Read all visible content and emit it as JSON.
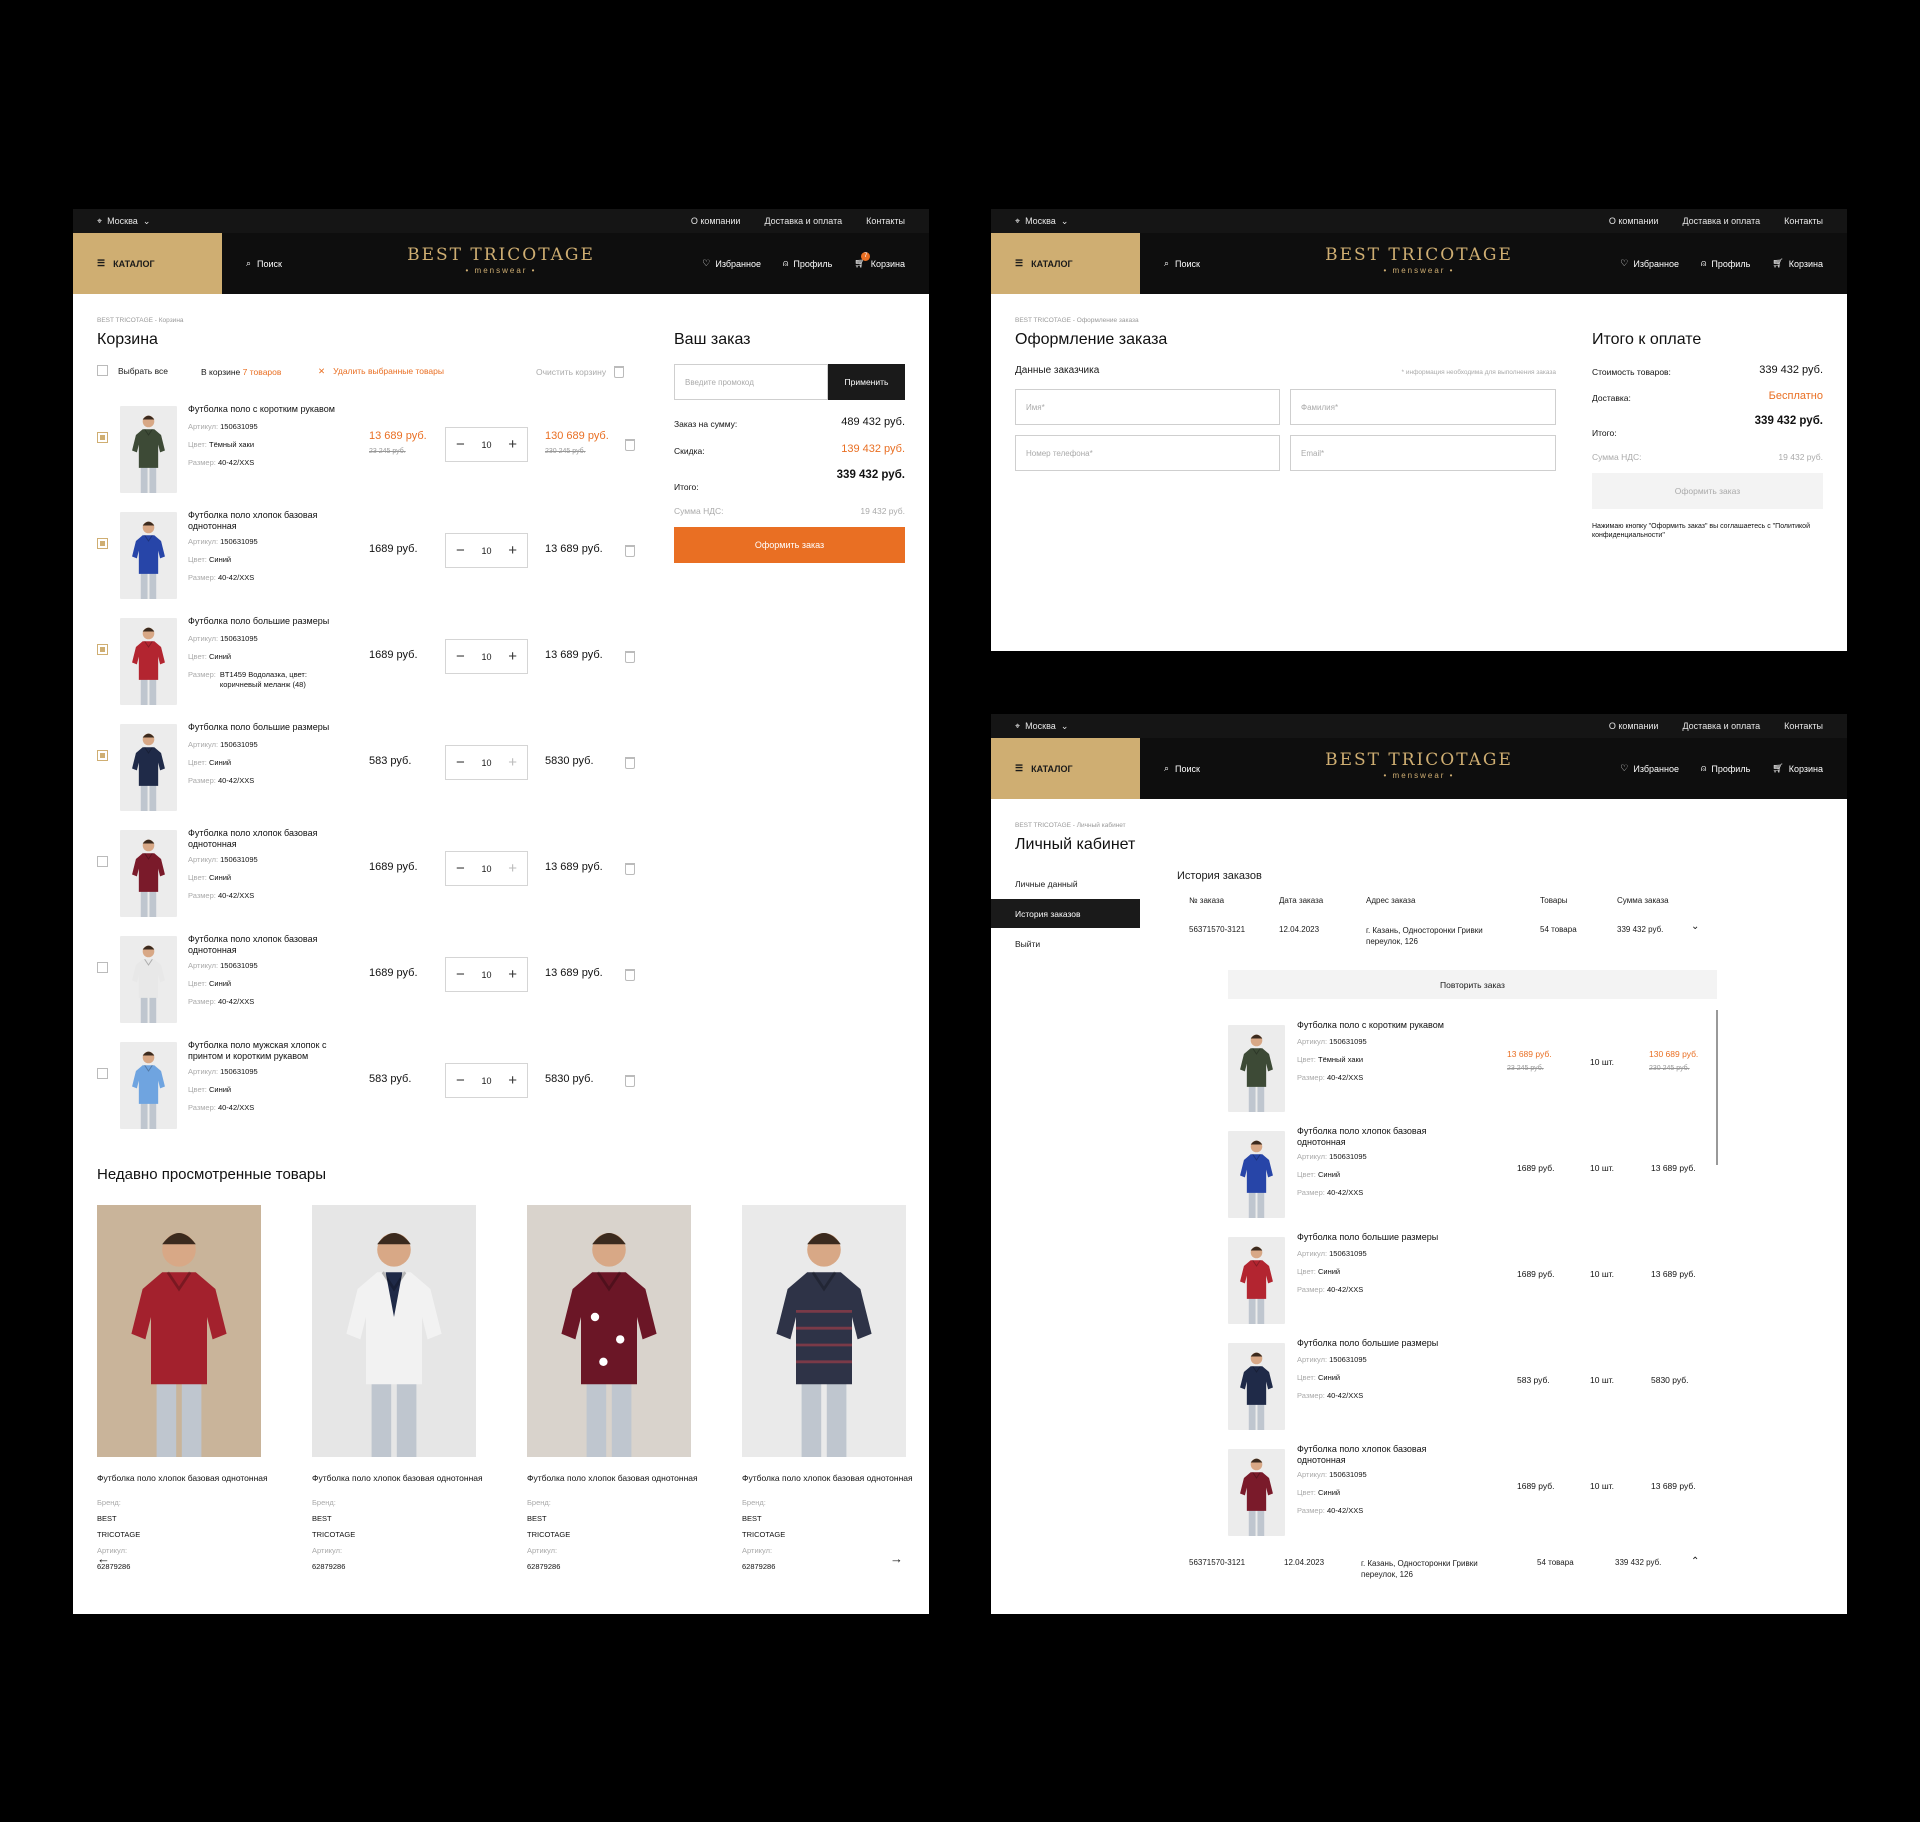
{
  "common": {
    "city": "Москва",
    "links": [
      "О компании",
      "Доставка и оплата",
      "Контакты"
    ],
    "catalog": "КАТАЛОГ",
    "search": "Поиск",
    "logo_main": "BEST TRICOTAGE",
    "logo_sub": "• menswear •",
    "favorites": "Избранное",
    "profile": "Профиль",
    "cart": "Корзина",
    "cart_count": "7",
    "brand_color": "#cfae72",
    "accent_color": "#e96f23"
  },
  "cart_page": {
    "breadcrumb": "BEST TRICOTAGE - Корзина",
    "title": "Корзина",
    "select_all": "Выбрать все",
    "in_cart_prefix": "В корзине",
    "in_cart_count": "7 товаров",
    "delete_selected": "Удалить выбранные товары",
    "clear_cart": "Очистить корзину",
    "meta_labels": {
      "article": "Артикул:",
      "color": "Цвет:",
      "size": "Размер:"
    },
    "items": [
      {
        "name": "Футболка поло с коротким рукавом",
        "article": "150631095",
        "color": "Тёмный хаки",
        "size": "40-42/XXS",
        "price": "13 689 руб.",
        "price_old": "23 245 руб.",
        "qty": "10",
        "total": "130 689 руб.",
        "total_old": "230 245 руб.",
        "checked": true,
        "discount": true
      },
      {
        "name": "Футболка поло хлопок базовая однотонная",
        "article": "150631095",
        "color": "Синий",
        "size": "40-42/XXS",
        "price": "1689 руб.",
        "qty": "10",
        "total": "13 689 руб.",
        "checked": true
      },
      {
        "name": "Футболка поло большие размеры",
        "article": "150631095",
        "color": "Синий",
        "size": "BT1459 Водолазка, цвет: коричневый меланж (48)",
        "price": "1689 руб.",
        "qty": "10",
        "total": "13 689 руб.",
        "checked": true
      },
      {
        "name": "Футболка поло большие размеры",
        "article": "150631095",
        "color": "Синий",
        "size": "40-42/XXS",
        "price": "583 руб.",
        "qty": "10",
        "total": "5830 руб.",
        "checked": true
      },
      {
        "name": "Футболка поло хлопок базовая однотонная",
        "article": "150631095",
        "color": "Синий",
        "size": "40-42/XXS",
        "price": "1689 руб.",
        "qty": "10",
        "total": "13 689 руб.",
        "checked": false
      },
      {
        "name": "Футболка поло хлопок базовая однотонная",
        "article": "150631095",
        "color": "Синий",
        "size": "40-42/XXS",
        "price": "1689 руб.",
        "qty": "10",
        "total": "13 689 руб.",
        "checked": false
      },
      {
        "name": "Футболка поло мужская хлопок с принтом и коротким рукавом",
        "article": "150631095",
        "color": "Синий",
        "size": "40-42/XXS",
        "price": "583 руб.",
        "qty": "10",
        "total": "5830 руб.",
        "checked": false
      }
    ],
    "order": {
      "title": "Ваш заказ",
      "promo_placeholder": "Введите промокод",
      "apply": "Применить",
      "sum_label": "Заказ на сумму:",
      "sum_value": "489 432 руб.",
      "discount_label": "Скидка:",
      "discount_value": "139 432 руб.",
      "subtotal": "339 432 руб.",
      "total_label": "Итого:",
      "vat_label": "Сумма НДС:",
      "vat_value": "19 432 руб.",
      "checkout": "Оформить заказ"
    },
    "recent": {
      "title": "Недавно просмотренные товары",
      "brand_label": "Бренд:",
      "article_label": "Артикул:",
      "cards": [
        {
          "name": "Футболка поло хлопок базовая однотонная",
          "brand": "BEST TRICOTAGE",
          "article": "62879286"
        },
        {
          "name": "Футболка поло хлопок базовая однотонная",
          "brand": "BEST TRICOTAGE",
          "article": "62879286"
        },
        {
          "name": "Футболка поло хлопок базовая однотонная",
          "brand": "BEST TRICOTAGE",
          "article": "62879286"
        },
        {
          "name": "Футболка поло хлопок базовая однотонная",
          "brand": "BEST TRICOTAGE",
          "article": "62879286"
        }
      ]
    }
  },
  "checkout_page": {
    "breadcrumb": "BEST TRICOTAGE - Оформление заказа",
    "title": "Оформление заказа",
    "customer_data": "Данные заказчика",
    "required_note": "* информация необходима для выполнения заказа",
    "fields": {
      "first_name": "Имя*",
      "last_name": "Фамилия*",
      "phone": "Номер телефона*",
      "email": "Email*"
    },
    "summary": {
      "title": "Итого к оплате",
      "goods_label": "Стоимость товаров:",
      "goods_value": "339 432 руб.",
      "delivery_label": "Доставка:",
      "delivery_value": "Бесплатно",
      "total_value": "339 432 руб.",
      "total_label": "Итого:",
      "vat_label": "Сумма НДС:",
      "vat_value": "19 432 руб.",
      "button": "Оформить заказ",
      "note": "Нажимаю кнопку \"Оформить заказ\" вы соглашаетесь с \"Политикой конфиденциальности\""
    }
  },
  "account_page": {
    "breadcrumb": "BEST TRICOTAGE - Личный кабинет",
    "title": "Личный кабинет",
    "menu": [
      "Личные данный",
      "История заказов",
      "Выйти"
    ],
    "history_title": "История заказов",
    "columns": [
      "№ заказа",
      "Дата заказа",
      "Адрес заказа",
      "Товары",
      "Сумма заказа"
    ],
    "orders": [
      {
        "number": "56371570-3121",
        "date": "12.04.2023",
        "address": "г. Казань, Односторонки Гривки переулок, 126",
        "goods": "54 товара",
        "sum": "339 432 руб."
      },
      {
        "number": "56371570-3121",
        "date": "12.04.2023",
        "address": "г. Казань, Односторонки Гривки переулок, 126",
        "goods": "54 товара",
        "sum": "339 432 руб."
      }
    ],
    "repeat": "Повторить заказ",
    "items": [
      {
        "name": "Футболка поло с коротким рукавом",
        "article": "150631095",
        "color": "Тёмный хаки",
        "size": "40-42/XXS",
        "price": "13 689 руб.",
        "price_old": "23 245 руб.",
        "qty": "10 шт.",
        "total": "130 689 руб.",
        "total_old": "230 245 руб."
      },
      {
        "name": "Футболка поло хлопок базовая однотонная",
        "article": "150631095",
        "color": "Синий",
        "size": "40-42/XXS",
        "price": "1689 руб.",
        "qty": "10 шт.",
        "total": "13 689 руб."
      },
      {
        "name": "Футболка поло большие размеры",
        "article": "150631095",
        "color": "Синий",
        "size": "40-42/XXS",
        "price": "1689 руб.",
        "qty": "10 шт.",
        "total": "13 689 руб."
      },
      {
        "name": "Футболка поло большие размеры",
        "article": "150631095",
        "color": "Синий",
        "size": "40-42/XXS",
        "price": "583 руб.",
        "qty": "10 шт.",
        "total": "5830 руб."
      },
      {
        "name": "Футболка поло хлопок базовая однотонная",
        "article": "150631095",
        "color": "Синий",
        "size": "40-42/XXS",
        "price": "1689 руб.",
        "qty": "10 шт.",
        "total": "13 689 руб."
      }
    ]
  }
}
